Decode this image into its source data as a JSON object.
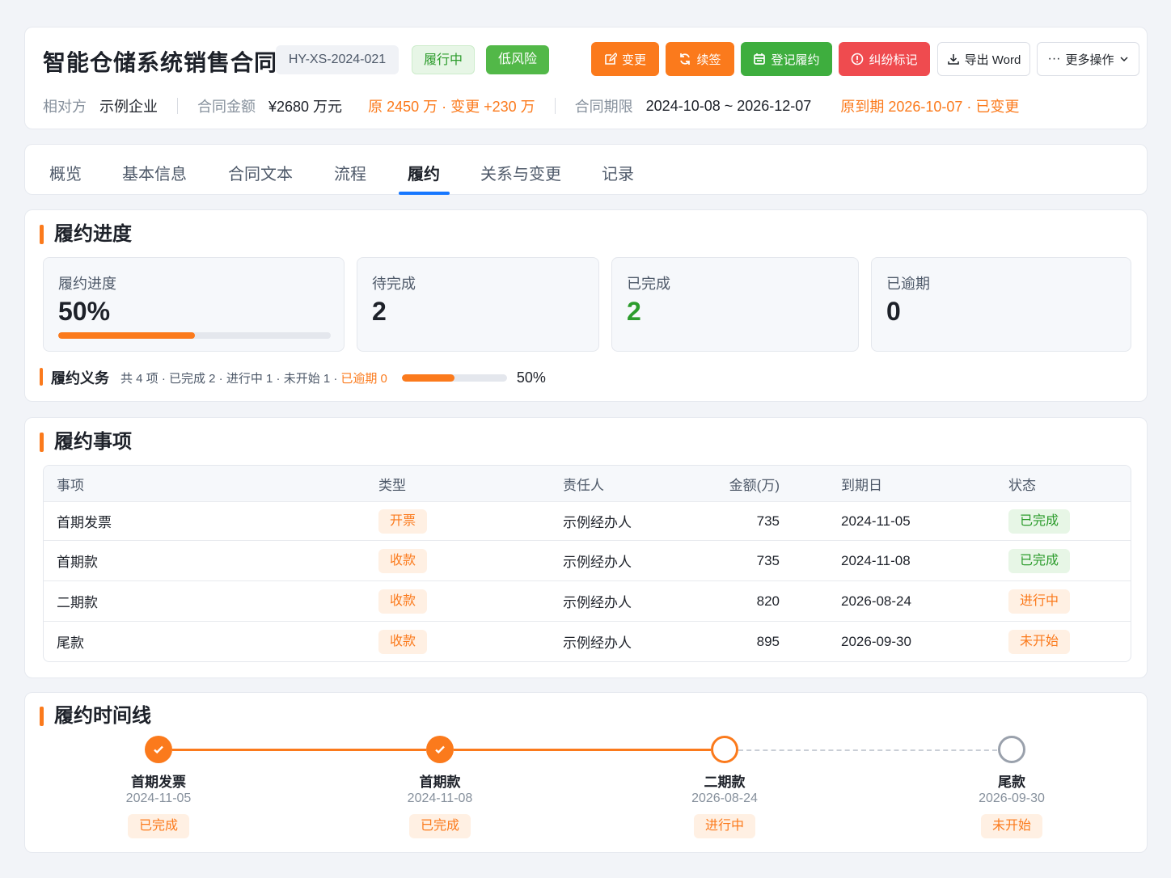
{
  "header": {
    "title": "智能仓储系统销售合同",
    "code": "HY-XS-2024-021",
    "status": "履行中",
    "risk": "低风险",
    "actions": {
      "change": "变更",
      "renew": "续签",
      "register": "登记履约",
      "dispute": "纠纷标记",
      "export": "导出 Word",
      "more": "更多操作"
    },
    "meta": {
      "party_label": "相对方",
      "party_value": "示例企业",
      "amount_label": "合同金额",
      "amount_value": "¥2680 万元",
      "amount_note": "原 2450 万 · 变更 +230 万",
      "period_label": "合同期限",
      "period_value": "2024-10-08 ~ 2026-12-07",
      "period_note": "原到期 2026-10-07 · 已变更"
    }
  },
  "tabs": [
    "概览",
    "基本信息",
    "合同文本",
    "流程",
    "履约",
    "关系与变更",
    "记录"
  ],
  "active_tab": "履约",
  "progress": {
    "title": "履约进度",
    "stats": {
      "progress_label": "履约进度",
      "progress_value": "50%",
      "progress_fraction": 0.5,
      "pending_label": "待完成",
      "pending_value": "2",
      "done_label": "已完成",
      "done_value": "2",
      "overdue_label": "已逾期",
      "overdue_value": "0"
    },
    "obligations": {
      "title": "履约义务",
      "summary": "共 4 项 · 已完成 2 · 进行中 1 · 未开始 1 ·",
      "overdue": "已逾期 0",
      "percent": "50%",
      "fraction": 0.5
    }
  },
  "items": {
    "title": "履约事项",
    "columns": [
      "事项",
      "类型",
      "责任人",
      "金额(万)",
      "到期日",
      "状态"
    ],
    "rows": [
      {
        "name": "首期发票",
        "type": "开票",
        "owner": "示例经办人",
        "amount": "735",
        "due": "2024-11-05",
        "status": "已完成",
        "status_color": "green"
      },
      {
        "name": "首期款",
        "type": "收款",
        "owner": "示例经办人",
        "amount": "735",
        "due": "2024-11-08",
        "status": "已完成",
        "status_color": "green"
      },
      {
        "name": "二期款",
        "type": "收款",
        "owner": "示例经办人",
        "amount": "820",
        "due": "2026-08-24",
        "status": "进行中",
        "status_color": "orange"
      },
      {
        "name": "尾款",
        "type": "收款",
        "owner": "示例经办人",
        "amount": "895",
        "due": "2026-09-30",
        "status": "未开始",
        "status_color": "orange"
      }
    ]
  },
  "timeline": {
    "title": "履约时间线",
    "nodes": [
      {
        "name": "首期发票",
        "date": "2024-11-05",
        "status": "已完成",
        "state": "done"
      },
      {
        "name": "首期款",
        "date": "2024-11-08",
        "status": "已完成",
        "state": "done"
      },
      {
        "name": "二期款",
        "date": "2026-08-24",
        "status": "进行中",
        "state": "doing"
      },
      {
        "name": "尾款",
        "date": "2026-09-30",
        "status": "未开始",
        "state": "todo"
      }
    ]
  },
  "colors": {
    "accent": "#fb7a1c",
    "success": "#2c9c2c",
    "danger": "#ef4b4f",
    "tab_ink": "#1677ff"
  },
  "icons": {
    "change": "edit-icon",
    "renew": "refresh-icon",
    "register": "calendar-icon",
    "dispute": "alert-icon",
    "export": "download-icon",
    "more": "ellipsis-icon",
    "check": "check-icon"
  }
}
